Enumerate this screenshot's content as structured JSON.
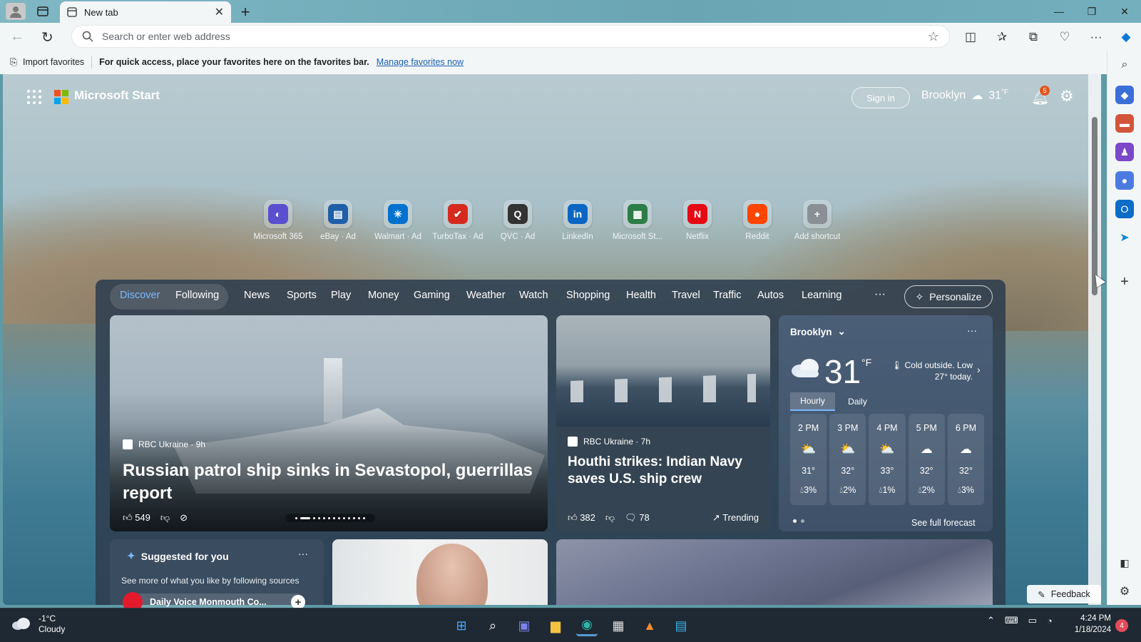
{
  "browser": {
    "tab_title": "New tab",
    "tab_close": "✕",
    "new_tab": "+",
    "window_controls": {
      "minimize": "—",
      "restore": "❐",
      "close": "✕"
    },
    "address_placeholder": "Search or enter web address",
    "favorites_bar": {
      "import_label": "Import favorites",
      "message": "For quick access, place your favorites here on the favorites bar.",
      "link": "Manage favorites now"
    },
    "sidebar_icons": [
      "search-icon",
      "shopping-tag-icon",
      "tools-icon",
      "games-icon",
      "microsoft-365-icon",
      "outlook-icon",
      "drop-icon",
      "add-icon"
    ]
  },
  "ms_start": {
    "title": "Microsoft Start",
    "sign_in": "Sign in",
    "header_city": "Brooklyn",
    "header_temp": "31",
    "header_unit": "°F",
    "notification_count": "5",
    "logo_colors": [
      "#f25022",
      "#7fba00",
      "#00a4ef",
      "#ffb900"
    ]
  },
  "shortcuts": [
    {
      "label": "Microsoft 365",
      "glyph": "◐",
      "color": "#5a4fcf"
    },
    {
      "label": "eBay · Ad",
      "glyph": "▤",
      "color": "#1f5fa8"
    },
    {
      "label": "Walmart · Ad",
      "glyph": "✳",
      "color": "#0071ce"
    },
    {
      "label": "TurboTax · Ad",
      "glyph": "✔",
      "color": "#d52b1e"
    },
    {
      "label": "QVC · Ad",
      "glyph": "Q",
      "color": "#333333"
    },
    {
      "label": "LinkedIn",
      "glyph": "in",
      "color": "#0a66c2"
    },
    {
      "label": "Microsoft St...",
      "glyph": "▦",
      "color": "#2d7d46"
    },
    {
      "label": "Netflix",
      "glyph": "N",
      "color": "#e50914"
    },
    {
      "label": "Reddit",
      "glyph": "●",
      "color": "#ff4500"
    },
    {
      "label": "Add shortcut",
      "glyph": "+",
      "color": "#8a8f96"
    }
  ],
  "nav": {
    "items": [
      "Discover",
      "Following",
      "News",
      "Sports",
      "Play",
      "Money",
      "Gaming",
      "Weather",
      "Watch",
      "Shopping",
      "Health",
      "Travel",
      "Traffic",
      "Autos",
      "Learning"
    ],
    "more": "···",
    "personalize": "Personalize"
  },
  "hero": {
    "source": "RBC Ukraine · 9h",
    "title": "Russian patrol ship sinks in Sevastopol, guerrillas report",
    "likes": "549"
  },
  "card2": {
    "source": "RBC Ukraine · 7h",
    "title": "Houthi strikes: Indian Navy saves U.S. ship crew",
    "likes": "382",
    "comments": "78",
    "trending": "Trending"
  },
  "weather": {
    "city": "Brooklyn",
    "temp": "31",
    "unit": "°F",
    "description": "Cold outside. Low 27° today.",
    "tabs": [
      "Hourly",
      "Daily"
    ],
    "hours": [
      {
        "time": "2 PM",
        "temp": "31°",
        "precip": "3%"
      },
      {
        "time": "3 PM",
        "temp": "32°",
        "precip": "2%"
      },
      {
        "time": "4 PM",
        "temp": "33°",
        "precip": "1%"
      },
      {
        "time": "5 PM",
        "temp": "32°",
        "precip": "2%"
      },
      {
        "time": "6 PM",
        "temp": "32°",
        "precip": "3%"
      }
    ],
    "see_full": "See full forecast"
  },
  "suggested": {
    "title": "Suggested for you",
    "subtitle": "See more of what you like by following sources",
    "source_name": "Daily Voice Monmouth Co..."
  },
  "feedback": "Feedback",
  "taskbar": {
    "weather_temp": "-1°C",
    "weather_desc": "Cloudy",
    "time": "4:24 PM",
    "date": "1/18/2024",
    "badge": "4"
  }
}
